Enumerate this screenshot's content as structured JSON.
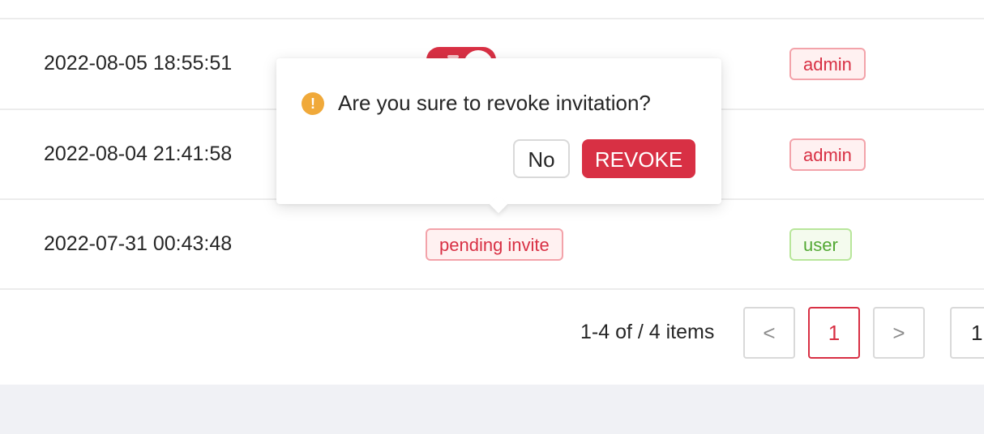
{
  "table": {
    "rows": [
      {
        "date": "2022-08-05 18:55:51",
        "role": "admin"
      },
      {
        "date": "2022-08-04 21:41:58",
        "role": "admin"
      },
      {
        "date": "2022-07-31 00:43:48",
        "status": "pending invite",
        "role": "user"
      }
    ]
  },
  "popconfirm": {
    "title": "Are you sure to revoke invitation?",
    "icon": "exclamation-circle-icon",
    "icon_glyph": "!",
    "cancel_label": "No",
    "confirm_label": "REVOKE"
  },
  "pagination": {
    "total_text": "1-4 of / 4 items",
    "prev_glyph": "<",
    "next_glyph": ">",
    "current_page": "1",
    "page_size_visible": "1"
  },
  "colors": {
    "accent": "#d83044",
    "warning": "#f0a93a",
    "user_tag": "#52a833",
    "footer_bg": "#f0f1f5"
  }
}
